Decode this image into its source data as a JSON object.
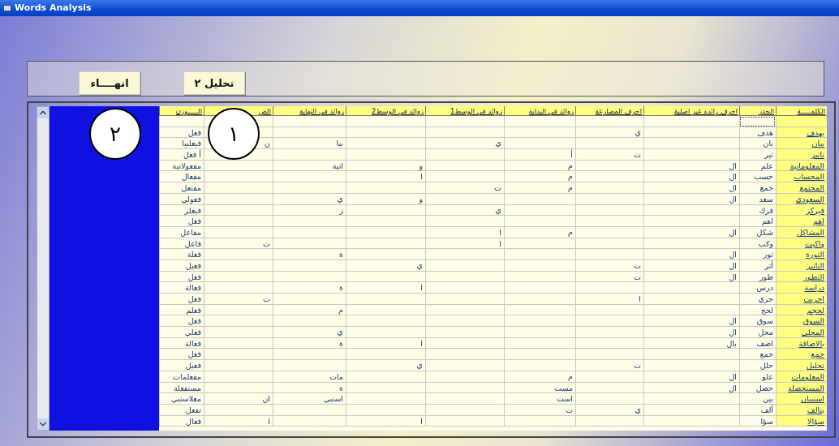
{
  "window": {
    "title": "Words Analysis"
  },
  "buttons": [
    {
      "label": "تحليل ٢"
    },
    {
      "label": "انهــــاء"
    }
  ],
  "callouts": [
    {
      "label": "١"
    },
    {
      "label": "٢"
    }
  ],
  "table": {
    "columns": [
      "الكلمـــــة",
      "الجذر",
      "احرف زائدة غير اصلية",
      "احرف المضارعة",
      "زوائد في البداية",
      "زوائد في الوسط1",
      "زوائد في الوسط2",
      "زوائد في النهاية",
      "الض",
      "الـــــوزن"
    ],
    "rows": [
      {
        "focused": true
      },
      {
        "focused": false,
        "word": "يهدف",
        "root": "هدف",
        "mudaraa": "ي",
        "weight": "فعل"
      },
      {
        "focused": false,
        "word": "بيان",
        "root": "بان",
        "mid1": "ي",
        "end": "بيا",
        "pron": "ن",
        "weight": "فيعلبيا"
      },
      {
        "focused": false,
        "word": "تاثير",
        "root": "ثير",
        "mudaraa": "ت",
        "start": "أ",
        "weight": "أ فعل"
      },
      {
        "focused": false,
        "word": "المعلوماتية",
        "root": "علم",
        "extra": "ال",
        "start": "م",
        "mid2": "و",
        "end": "اتية",
        "weight": "مفعولاتية"
      },
      {
        "focused": false,
        "word": "المحساب",
        "root": "حسب",
        "extra": "ال",
        "start": "م",
        "mid2": "ا",
        "weight": "مفعال"
      },
      {
        "focused": false,
        "word": "المجتمع",
        "root": "جمع",
        "extra": "ال",
        "start": "م",
        "mid1": "ت",
        "weight": "مفتعل"
      },
      {
        "focused": false,
        "word": "السعودي",
        "root": "سعد",
        "extra": "ال",
        "mid2": "و",
        "end": "ي",
        "weight": "فعولي"
      },
      {
        "focused": false,
        "word": "فيركز",
        "root": "فرك",
        "mid1": "ي",
        "end": "ز",
        "weight": "فيعلز"
      },
      {
        "focused": false,
        "word": "اهم",
        "root": "اهم",
        "weight": "فعل"
      },
      {
        "focused": false,
        "word": "المشاكل",
        "root": "شكل",
        "extra": "ال",
        "start": "م",
        "mid1": "ا",
        "weight": "مفاعل"
      },
      {
        "focused": false,
        "word": "واكبت",
        "root": "وكب",
        "mid1": "ا",
        "pron": "ت",
        "weight": "فاعل"
      },
      {
        "focused": false,
        "word": "الثورة",
        "root": "ثور",
        "extra": "ال",
        "end": "ة",
        "weight": "فعلة"
      },
      {
        "focused": false,
        "word": "التاثير",
        "root": "أثر",
        "extra": "ال",
        "mudaraa": "ت",
        "mid2": "ي",
        "weight": "فعيل"
      },
      {
        "focused": false,
        "word": "التطور",
        "root": "طور",
        "extra": "ال",
        "mudaraa": "ت",
        "weight": "فعل"
      },
      {
        "focused": false,
        "word": "دراسة",
        "root": "درس",
        "mid2": "ا",
        "end": "ة",
        "weight": "فعالة"
      },
      {
        "focused": false,
        "word": "اجريت",
        "root": "جري",
        "mudaraa": "ا",
        "pron": "ت",
        "weight": "فعل"
      },
      {
        "focused": false,
        "word": "لحجم",
        "root": "لحج",
        "end": "م",
        "weight": "فعلم"
      },
      {
        "focused": false,
        "word": "السوق",
        "root": "سوق",
        "extra": "ال",
        "weight": "فعل"
      },
      {
        "focused": false,
        "word": "المحلي",
        "root": "محل",
        "extra": "ال",
        "end": "ي",
        "weight": "فعلي"
      },
      {
        "focused": false,
        "word": "بالاضافة",
        "root": "اضف",
        "extra": "بال",
        "mid2": "ا",
        "end": "ة",
        "weight": "فعالة"
      },
      {
        "focused": false,
        "word": "جمع",
        "root": "جمع",
        "weight": "فعل"
      },
      {
        "focused": false,
        "word": "تحليل",
        "root": "حلل",
        "mudaraa": "ت",
        "mid2": "ي",
        "weight": "فعيل"
      },
      {
        "focused": false,
        "word": "المعلومات",
        "root": "علو",
        "extra": "ال",
        "start": "م",
        "end": "مات",
        "weight": "مفعلمات"
      },
      {
        "focused": false,
        "word": "المستحصلة",
        "root": "حصل",
        "extra": "ال",
        "start": "مست",
        "end": "ة",
        "weight": "مستفعلة"
      },
      {
        "focused": false,
        "word": "استبيان",
        "root": "بين",
        "start": "است",
        "end": "استبي",
        "pron": "ان",
        "weight": "معلاستبي"
      },
      {
        "focused": false,
        "word": "يتالف",
        "root": "ألف",
        "mudaraa": "ي",
        "start": "ت",
        "weight": "تفعل"
      },
      {
        "focused": false,
        "word": "سؤالا",
        "root": "سؤا",
        "mid2": "ا",
        "pron": "ا",
        "weight": "فعال"
      }
    ]
  }
}
